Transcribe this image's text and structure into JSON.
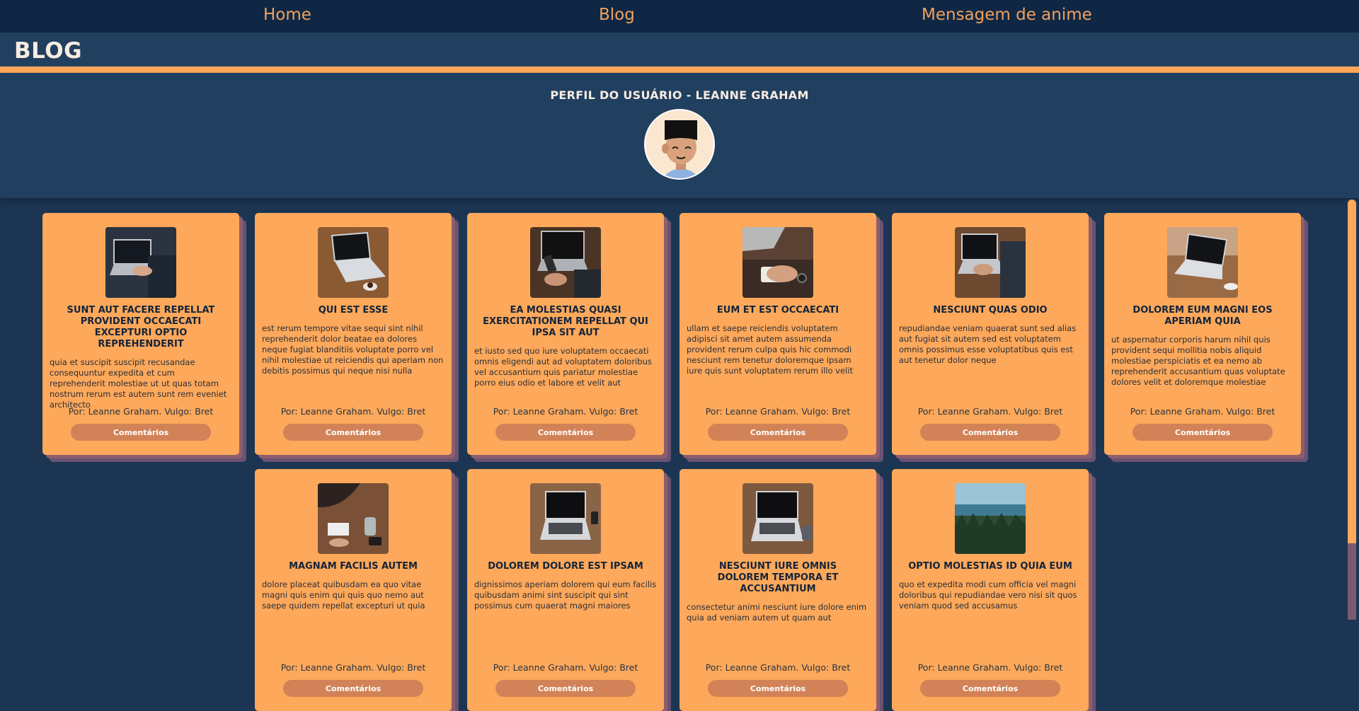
{
  "nav": {
    "home": "Home",
    "blog": "Blog",
    "anime": "Mensagem de anime"
  },
  "header": {
    "title": "BLOG"
  },
  "profile": {
    "title": "PERFIL DO USUÁRIO - LEANNE GRAHAM"
  },
  "posts": [
    {
      "title": "SUNT AUT FACERE REPELLAT PROVIDENT OCCAECATI EXCEPTURI OPTIO REPREHENDERIT",
      "body": "quia et suscipit suscipit recusandae consequuntur expedita et cum reprehenderit molestiae ut ut quas totam nostrum rerum est autem sunt rem eveniet architecto",
      "byline": "Por: Leanne Graham. Vulgo: Bret",
      "button": "Comentários",
      "image": "laptop-typing-photo"
    },
    {
      "title": "QUI EST ESSE",
      "body": "est rerum tempore vitae sequi sint nihil reprehenderit dolor beatae ea dolores neque fugiat blanditiis voluptate porro vel nihil molestiae ut reiciendis qui aperiam non debitis possimus qui neque nisi nulla",
      "byline": "Por: Leanne Graham. Vulgo: Bret",
      "button": "Comentários",
      "image": "laptop-desk-photo"
    },
    {
      "title": "EA MOLESTIAS QUASI EXERCITATIONEM REPELLAT QUI IPSA SIT AUT",
      "body": "et iusto sed quo iure voluptatem occaecati omnis eligendi aut ad voluptatem doloribus vel accusantium quis pariatur molestiae porro eius odio et labore et velit aut",
      "byline": "Por: Leanne Graham. Vulgo: Bret",
      "button": "Comentários",
      "image": "laptop-phone-photo"
    },
    {
      "title": "EUM ET EST OCCAECATI",
      "body": "ullam et saepe reiciendis voluptatem adipisci sit amet autem assumenda provident rerum culpa quis hic commodi nesciunt rem tenetur doloremque ipsam iure quis sunt voluptatem rerum illo velit",
      "byline": "Por: Leanne Graham. Vulgo: Bret",
      "button": "Comentários",
      "image": "hands-notebook-photo"
    },
    {
      "title": "NESCIUNT QUAS ODIO",
      "body": "repudiandae veniam quaerat sunt sed alias aut fugiat sit autem sed est voluptatem omnis possimus esse voluptatibus quis est aut tenetur dolor neque",
      "byline": "Por: Leanne Graham. Vulgo: Bret",
      "button": "Comentários",
      "image": "laptop-typing-photo"
    },
    {
      "title": "DOLOREM EUM MAGNI EOS APERIAM QUIA",
      "body": "ut aspernatur corporis harum nihil quis provident sequi mollitia nobis aliquid molestiae perspiciatis et ea nemo ab reprehenderit accusantium quas voluptate dolores velit et doloremque molestiae",
      "byline": "Por: Leanne Graham. Vulgo: Bret",
      "button": "Comentários",
      "image": "laptop-cafe-photo"
    },
    {
      "title": "MAGNAM FACILIS AUTEM",
      "body": "dolore placeat quibusdam ea quo vitae magni quis enim qui quis quo nemo aut saepe quidem repellat excepturi ut quia",
      "byline": "Por: Leanne Graham. Vulgo: Bret",
      "button": "Comentários",
      "image": "meeting-table-photo"
    },
    {
      "title": "DOLOREM DOLORE EST IPSAM",
      "body": "dignissimos aperiam dolorem qui eum facilis quibusdam animi sint suscipit qui sint possimus cum quaerat magni maiores",
      "byline": "Por: Leanne Graham. Vulgo: Bret",
      "button": "Comentários",
      "image": "laptop-wood-photo"
    },
    {
      "title": "NESCIUNT IURE OMNIS DOLOREM TEMPORA ET ACCUSANTIUM",
      "body": "consectetur animi nesciunt iure dolore enim quia ad veniam autem ut quam aut",
      "byline": "Por: Leanne Graham. Vulgo: Bret",
      "button": "Comentários",
      "image": "laptop-wood-photo"
    },
    {
      "title": "OPTIO MOLESTIAS ID QUIA EUM",
      "body": "quo et expedita modi cum officia vel magni doloribus qui repudiandae vero nisi sit quos veniam quod sed accusamus",
      "byline": "Por: Leanne Graham. Vulgo: Bret",
      "button": "Comentários",
      "image": "forest-lake-photo"
    }
  ],
  "colors": {
    "page_bg": "#1c3553",
    "nav_bg": "#0f2744",
    "accent": "#fda85a",
    "button": "#d28257",
    "card_title": "#13243a"
  }
}
